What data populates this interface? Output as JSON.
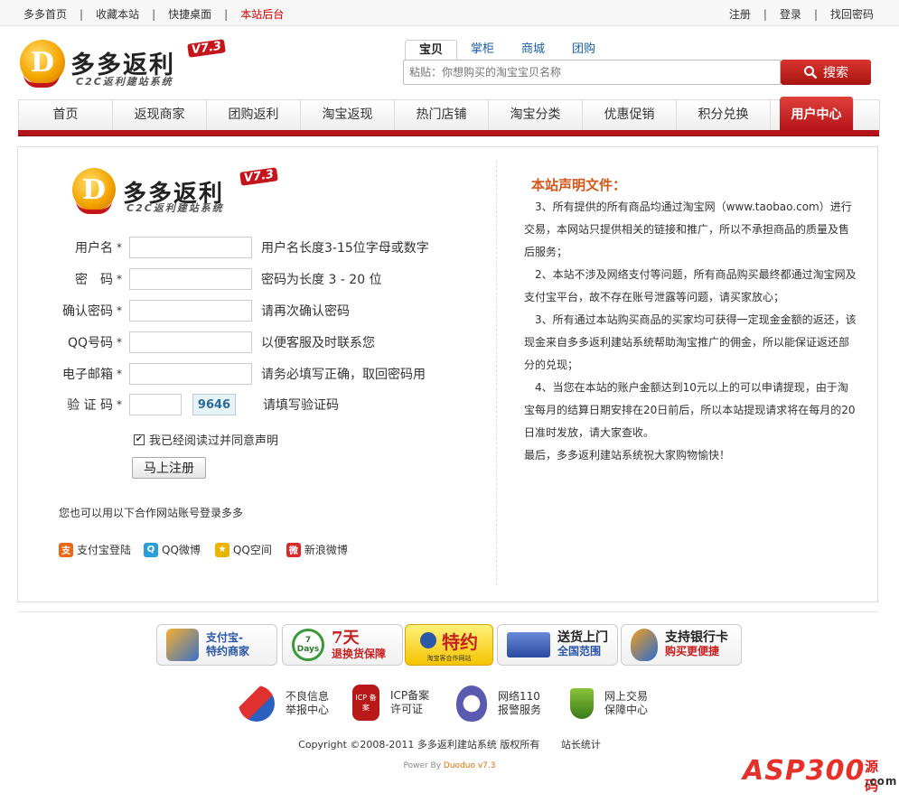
{
  "topbar": {
    "left": [
      {
        "label": "多多首页"
      },
      {
        "label": "收藏本站"
      },
      {
        "label": "快捷桌面"
      },
      {
        "label": "本站后台"
      }
    ],
    "right": [
      {
        "label": "注册"
      },
      {
        "label": "登录"
      },
      {
        "label": "找回密码"
      }
    ]
  },
  "logo": {
    "title": "多多返利",
    "version": "V7.3",
    "subtitle": "C2C返利建站系统",
    "mark_letter": "D"
  },
  "search": {
    "tabs": [
      "宝贝",
      "掌柜",
      "商城",
      "团购"
    ],
    "active_tab": "宝贝",
    "placeholder": "粘贴：你想购买的淘宝宝贝名称",
    "button_label": "搜索"
  },
  "nav": {
    "items": [
      "首页",
      "返现商家",
      "团购返利",
      "淘宝返现",
      "热门店铺",
      "淘宝分类",
      "优惠促销",
      "积分兑换",
      "用户中心"
    ],
    "active": "用户中心"
  },
  "form": {
    "fields": [
      {
        "label": "用户名",
        "required": "*",
        "hint": "用户名长度3-15位字母或数字",
        "value": ""
      },
      {
        "label": "密　码",
        "required": "*",
        "hint": "密码为长度  3 - 20 位",
        "value": ""
      },
      {
        "label": "确认密码",
        "required": "*",
        "hint": "请再次确认密码",
        "value": ""
      },
      {
        "label": "QQ号码",
        "required": "*",
        "hint": "以便客服及时联系您",
        "value": ""
      },
      {
        "label": "电子邮箱",
        "required": "*",
        "hint": "请务必填写正确，取回密码用",
        "value": ""
      },
      {
        "label": "验 证 码",
        "required": "*",
        "hint": "请填写验证码",
        "value": ""
      }
    ],
    "captcha_code": "9646",
    "agree_label": "我已经阅读过并同意声明",
    "agree_checked": true,
    "submit_label": "马上注册",
    "partner_intro": "您也可以用以下合作网站账号登录多多",
    "partners": [
      {
        "label": "支付宝登陆",
        "icon": "alipay-icon",
        "color": "#e86a1a",
        "glyph": "支"
      },
      {
        "label": "QQ微博",
        "icon": "qq-weibo-icon",
        "color": "#2a9ed8",
        "glyph": "Q"
      },
      {
        "label": "QQ空间",
        "icon": "qzone-icon",
        "color": "#e8b400",
        "glyph": "★"
      },
      {
        "label": "新浪微博",
        "icon": "sina-weibo-icon",
        "color": "#d82a2a",
        "glyph": "微"
      }
    ]
  },
  "notice": {
    "title": "本站声明文件：",
    "paragraphs": [
      "　3、所有提供的所有商品均通过淘宝网（www.taobao.com）进行交易，本网站只提供相关的链接和推广，所以不承担商品的质量及售后服务；",
      "　2、本站不涉及网络支付等问题，所有商品购买最终都通过淘宝网及支付宝平台，故不存在账号泄露等问题，请买家放心；",
      "　3、所有通过本站购买商品的买家均可获得一定现金金额的返还，该现金来自多多返利建站系统帮助淘宝推广的佣金，所以能保证返还部分的兑现；",
      "　4、当您在本站的账户金额达到10元以上的可以申请提现，由于淘宝每月的结算日期安排在20日前后，所以本站提现请求将在每月的20日准时发放，请大家查收。",
      "最后，多多返利建站系统祝大家购物愉快！"
    ]
  },
  "badges": [
    {
      "line1": "支付宝-",
      "line2": "特约商家",
      "icon": "puzzle-icon",
      "color": "#f0a020"
    },
    {
      "line1": "7天",
      "line2": "退换货保障",
      "icon": "seven-days-icon",
      "color": "#3a9a3a",
      "circle": "7 Days"
    },
    {
      "line1": "特约",
      "line2": "淘宝客合作网站",
      "icon": "taobaoke-icon",
      "color": "#f5c400"
    },
    {
      "line1": "送货上门",
      "line2": "全国范围",
      "icon": "truck-icon",
      "color": "#2a60b0"
    },
    {
      "line1": "支持银行卡",
      "line2": "购买更便捷",
      "icon": "shield-card-icon",
      "color": "#2a6ad0"
    }
  ],
  "certs": [
    {
      "line1": "不良信息",
      "line2": "举报中心",
      "icon": "report-icon",
      "color": "#c82020"
    },
    {
      "line1": "ICP备案",
      "line2": "许可证",
      "icon": "icp-icon",
      "color": "#c82020",
      "glyph": "ICP 备案"
    },
    {
      "line1": "网络110",
      "line2": "报警服务",
      "icon": "police-icon",
      "color": "#5050a0"
    },
    {
      "line1": "网上交易",
      "line2": "保障中心",
      "icon": "trade-guard-icon",
      "color": "#5a9a2a"
    }
  ],
  "footer": {
    "copyright": "Copyright ©2008-2011  多多返利建站系统  版权所有",
    "stats": "站长统计",
    "power_prefix": "Power By ",
    "power_brand": "Duoduo",
    "power_version": " v7.3"
  },
  "watermark": {
    "text": "ASP300",
    "zh": "源码",
    "com": ".com"
  }
}
